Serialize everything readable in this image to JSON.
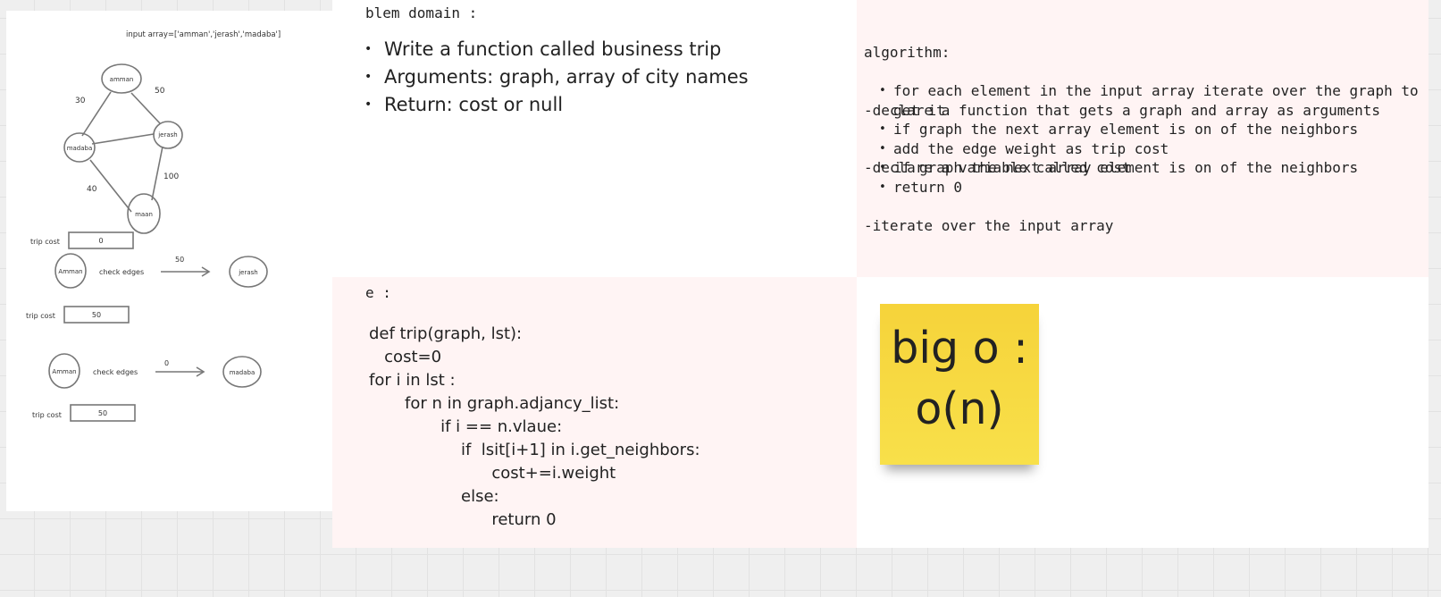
{
  "sketch": {
    "input_caption": "input array=['amman','jerash','madaba']",
    "nodes": {
      "amman": "amman",
      "jerash": "jerash",
      "madaba": "madaba",
      "maan": "maan"
    },
    "edge_weights": {
      "amman_madaba": "30",
      "amman_jerash": "50",
      "madaba_maan": "40",
      "jerash_maan": "100"
    },
    "trip_cost_label": "trip cost",
    "check_edges_label": "check edges",
    "step0_cost": "0",
    "step1": {
      "from": "Amman",
      "weight": "50",
      "to": "jerash",
      "cost": "50"
    },
    "step2": {
      "from": "Amman",
      "weight": "0",
      "to": "madaba",
      "cost": "50"
    }
  },
  "problem": {
    "heading": "blem domain :",
    "items": [
      "Write a function called business trip",
      "Arguments: graph, array of city names",
      "Return: cost or null"
    ]
  },
  "algorithm": {
    "lines": [
      "algorithm:",
      "-declare a function that gets a graph and array as arguments",
      "-declare a variable called cost",
      "-iterate over the input array"
    ],
    "bullets": [
      "for each element in the input array iterate over the graph to get it",
      "if graph the next array element is on of the neighbors",
      "add the edge weight  as trip cost",
      "if graph the next array element is on of the neighbors",
      "return 0"
    ]
  },
  "code": {
    "heading": "e :",
    "lines": [
      "def trip(graph, lst):",
      "   cost=0",
      "for i in lst :",
      "       for n in graph.adjancy_list:",
      "              if i == n.vlaue:",
      "                  if  lsit[i+1] in i.get_neighbors:",
      "                        cost+=i.weight",
      "                  else:",
      "                        return 0"
    ]
  },
  "bigo": {
    "line1": "big o :",
    "line2": "o(n)"
  }
}
